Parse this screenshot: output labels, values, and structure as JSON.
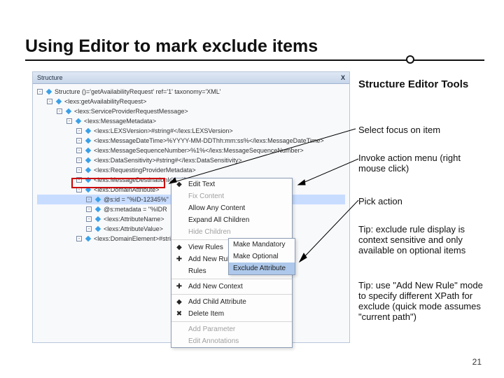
{
  "slide": {
    "title": "Using Editor to mark exclude items",
    "page_number": "21"
  },
  "annotations": {
    "heading": "Structure Editor Tools",
    "step1": "Select focus on item",
    "step2": "Invoke action menu (right mouse click)",
    "step3": "Pick action",
    "tip1": "Tip: exclude rule display is context sensitive and only available on optional items",
    "tip2": "Tip: use \"Add New Rule\" mode to specify different XPath for exclude (quick mode assumes \"current path\")"
  },
  "editor": {
    "panel_title": "Structure",
    "close_glyph": "X",
    "tree_lines": [
      "Structure  ()='getAvailabilityRequest' ref='1' taxonomy='XML'",
      "<lexs:getAvailabilityRequest>",
      "<lexs:ServiceProviderRequestMessage>",
      "<lexs:MessageMetadata>",
      "<lexs:LEXSVersion>#string#</lexs:LEXSVersion>",
      "<lexs:MessageDateTime>%YYYY-MM-DDThh:mm:ss%</lexs:MessageDateTime>",
      "<lexs:MessageSequenceNumber>%1%</lexs:MessageSequenceNumber>",
      "<lexs:DataSensitivity>#string#</lexs:DataSensitivity>",
      "<lexs:RequestingProviderMetadata>",
      "<lexs:MessageDestinationIdentifier>",
      "<lexs:DomainAttribute>",
      "@s:id = \"%ID-12345%\"",
      "@s:metadata = \"%IDR",
      "<lexs:AttributeName>",
      "<lexs:AttributeValue>",
      "<lexs:DomainElement>#string#</lexs:"
    ],
    "selected_line_index": 11,
    "context_menu": {
      "items": [
        {
          "label": "Edit Text",
          "icon": "pencil-icon"
        },
        {
          "label": "Fix Content",
          "disabled": true
        },
        {
          "label": "Allow Any Content"
        },
        {
          "label": "Expand All Children"
        },
        {
          "label": "Hide Children",
          "disabled": true
        },
        {
          "sep": true
        },
        {
          "label": "View Rules",
          "icon": "view-icon"
        },
        {
          "label": "Add New Rule",
          "icon": "add-icon"
        },
        {
          "label": "Rules",
          "submenu": true
        },
        {
          "sep": true
        },
        {
          "label": "Add New Context",
          "icon": "add-icon"
        },
        {
          "sep": true
        },
        {
          "label": "Add Child Attribute",
          "icon": "attr-icon"
        },
        {
          "label": "Delete Item",
          "icon": "delete-icon"
        },
        {
          "sep": true
        },
        {
          "label": "Add Parameter",
          "disabled": true
        },
        {
          "label": "Edit Annotations",
          "disabled": true
        }
      ],
      "rules_submenu": [
        "Make Mandatory",
        "Make Optional",
        "Exclude Attribute"
      ],
      "highlighted_submenu_index": 2
    }
  }
}
